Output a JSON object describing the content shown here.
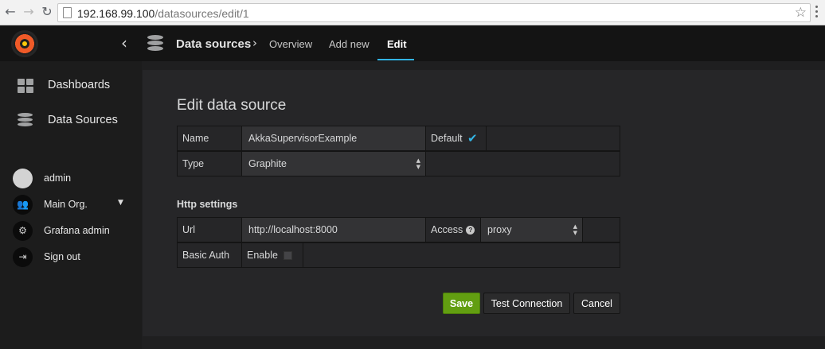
{
  "browser": {
    "url_host": "192.168.99.100",
    "url_path": "/datasources/edit/1"
  },
  "topnav": {
    "breadcrumb_title": "Data sources",
    "tabs": [
      "Overview",
      "Add new",
      "Edit"
    ],
    "active_tab": "Edit"
  },
  "sidebar": {
    "items": [
      {
        "label": "Dashboards",
        "icon": "dashboards-grid-icon"
      },
      {
        "label": "Data Sources",
        "icon": "database-icon"
      }
    ],
    "user": [
      {
        "label": "admin",
        "icon": "user-avatar-icon"
      },
      {
        "label": "Main Org.",
        "icon": "users-icon"
      },
      {
        "label": "Grafana admin",
        "icon": "gear-icon"
      },
      {
        "label": "Sign out",
        "icon": "sign-out-icon"
      }
    ]
  },
  "form": {
    "title": "Edit data source",
    "name_label": "Name",
    "name_value": "AkkaSupervisorExample",
    "default_label": "Default",
    "default_checked": true,
    "type_label": "Type",
    "type_value": "Graphite",
    "http_heading": "Http settings",
    "url_label": "Url",
    "url_value": "http://localhost:8000",
    "access_label": "Access",
    "access_value": "proxy",
    "basic_auth_label": "Basic Auth",
    "enable_label": "Enable",
    "enable_checked": false
  },
  "buttons": {
    "save": "Save",
    "test": "Test Connection",
    "cancel": "Cancel"
  },
  "colors": {
    "accent": "#33b5e5",
    "save_green": "#629e11"
  }
}
